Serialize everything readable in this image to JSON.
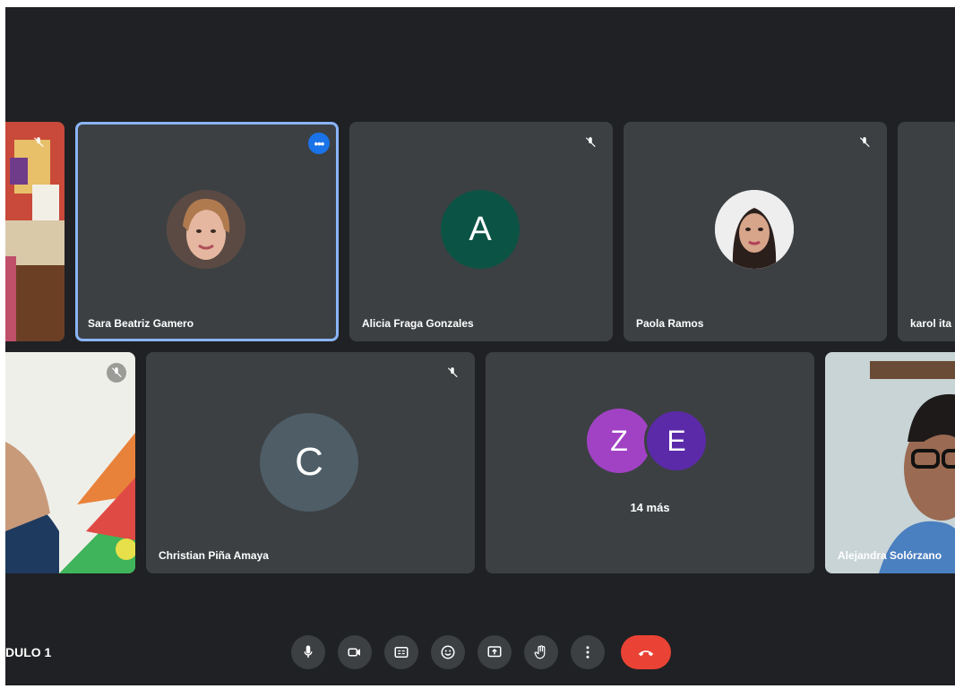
{
  "participants": {
    "sara": {
      "name": "Sara Beatriz Gamero"
    },
    "alicia": {
      "name": "Alicia Fraga Gonzales",
      "initial": "A",
      "color": "#0b5345"
    },
    "paola": {
      "name": "Paola Ramos"
    },
    "karol": {
      "name": "karol ita"
    },
    "christian": {
      "name": "Christian Piña Amaya",
      "initial": "C",
      "color": "#4e5d66"
    },
    "alejandra": {
      "name": "Alejandra Solórzano"
    }
  },
  "overflow": {
    "avatar1": "Z",
    "avatar2": "E",
    "count_label": "14 más"
  },
  "meeting": {
    "title": "DULO 1"
  },
  "controls": {
    "icons": [
      "mic-icon",
      "camera-icon",
      "captions-icon",
      "emoji-icon",
      "present-icon",
      "raise-hand-icon",
      "more-options-icon",
      "end-call-icon"
    ],
    "end_color": "#ea4335"
  },
  "colors": {
    "background": "#202124",
    "tile": "#3c4043",
    "active_border": "#8ab4f8",
    "accent": "#1a73e8"
  }
}
